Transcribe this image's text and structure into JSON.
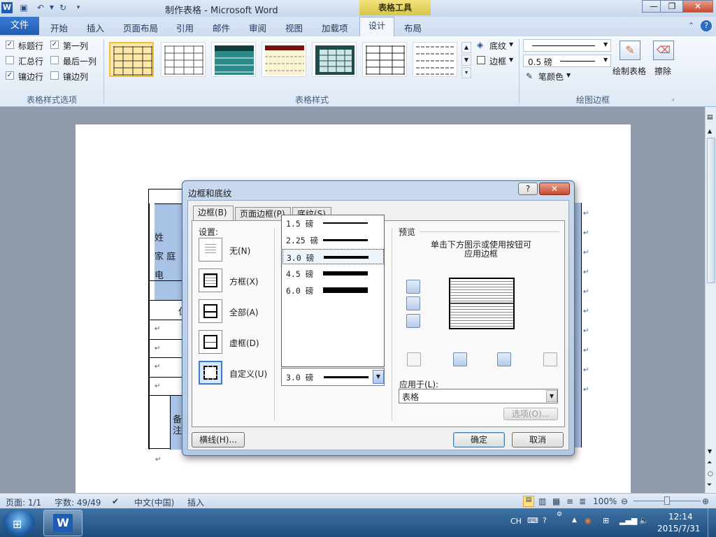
{
  "window": {
    "title": "制作表格 - Microsoft Word",
    "context_tab": "表格工具"
  },
  "ribbon": {
    "tabs": [
      "文件",
      "开始",
      "插入",
      "页面布局",
      "引用",
      "邮件",
      "审阅",
      "视图",
      "加载项",
      "设计",
      "布局"
    ],
    "active_tab": "设计",
    "style_options": {
      "label": "表格样式选项",
      "items": [
        {
          "label": "标题行",
          "checked": true
        },
        {
          "label": "第一列",
          "checked": true
        },
        {
          "label": "汇总行",
          "checked": false
        },
        {
          "label": "最后一列",
          "checked": false
        },
        {
          "label": "镶边行",
          "checked": true
        },
        {
          "label": "镶边列",
          "checked": false
        }
      ]
    },
    "table_styles": {
      "label": "表格样式",
      "shading": "底纹",
      "borders": "边框"
    },
    "draw_borders": {
      "label": "绘图边框",
      "weight": "0.5 磅",
      "pen_color": "笔颜色",
      "draw_table": "绘制表格",
      "eraser": "擦除"
    }
  },
  "document": {
    "cells": [
      "姓",
      "家 庭",
      "电",
      "仼",
      "备",
      "注"
    ],
    "para_marks": [
      "↵",
      "↵",
      "↵",
      "↵",
      "↵",
      "↵"
    ]
  },
  "dialog": {
    "title": "边框和底纹",
    "help": "?",
    "close": "✕",
    "tabs": [
      "边框(B)",
      "页面边框(P)",
      "底纹(S)"
    ],
    "settings_label": "设置:",
    "settings": [
      "无(N)",
      "方框(X)",
      "全部(A)",
      "虚框(D)",
      "自定义(U)"
    ],
    "width_options": [
      {
        "label": "1.5 磅",
        "thickness": 1.5
      },
      {
        "label": "2.25 磅",
        "thickness": 2.25
      },
      {
        "label": "3.0 磅",
        "thickness": 3
      },
      {
        "label": "4.5 磅",
        "thickness": 4.5
      },
      {
        "label": "6.0 磅",
        "thickness": 6
      }
    ],
    "selected_width": "3.0 磅",
    "preview_label": "预览",
    "preview_hint_1": "单击下方图示或使用按钮可",
    "preview_hint_2": "应用边框",
    "apply_to_label": "应用于(L):",
    "apply_to_value": "表格",
    "options_button": "选项(O)...",
    "hline_button": "横线(H)...",
    "ok_button": "确定",
    "cancel_button": "取消"
  },
  "status_bar": {
    "page": "页面: 1/1",
    "words": "字数: 49/49",
    "language": "中文(中国)",
    "mode": "插入",
    "zoom": "100%"
  },
  "taskbar": {
    "ime": "CH",
    "time": "12:14",
    "date": "2015/7/31"
  }
}
